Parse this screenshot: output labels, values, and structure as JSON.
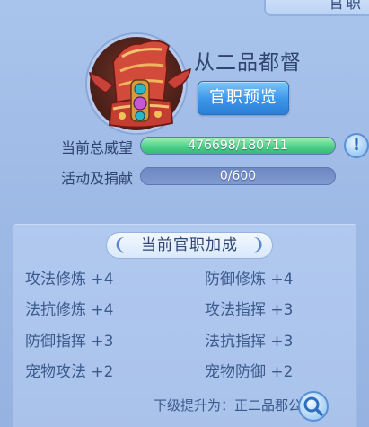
{
  "header": {
    "tab_label": "官职"
  },
  "rank": {
    "title": "从二品都督",
    "preview_label": "官职预览"
  },
  "stats": {
    "prestige_label": "当前总威望",
    "prestige_value": "476698/180711",
    "prestige_fill": 1.0,
    "activity_label": "活动及捐献",
    "activity_value": "0/600",
    "activity_fill": 0.0
  },
  "bonus": {
    "title": "当前官职加成",
    "items": [
      "攻法修炼 +4",
      "防御修炼 +4",
      "法抗修炼 +4",
      "攻法指挥 +3",
      "防御指挥 +3",
      "法抗指挥 +3",
      "宠物攻法 +2",
      "宠物防御 +2"
    ]
  },
  "footer": {
    "next_rank_text": "下级提升为：正二品郡公"
  },
  "icons": {
    "badge": "official-hat-icon",
    "info": "exclamation-icon",
    "search": "magnifier-icon"
  },
  "colors": {
    "accent_button": "#3c95e8",
    "progress_fill": "#4fd18a"
  }
}
